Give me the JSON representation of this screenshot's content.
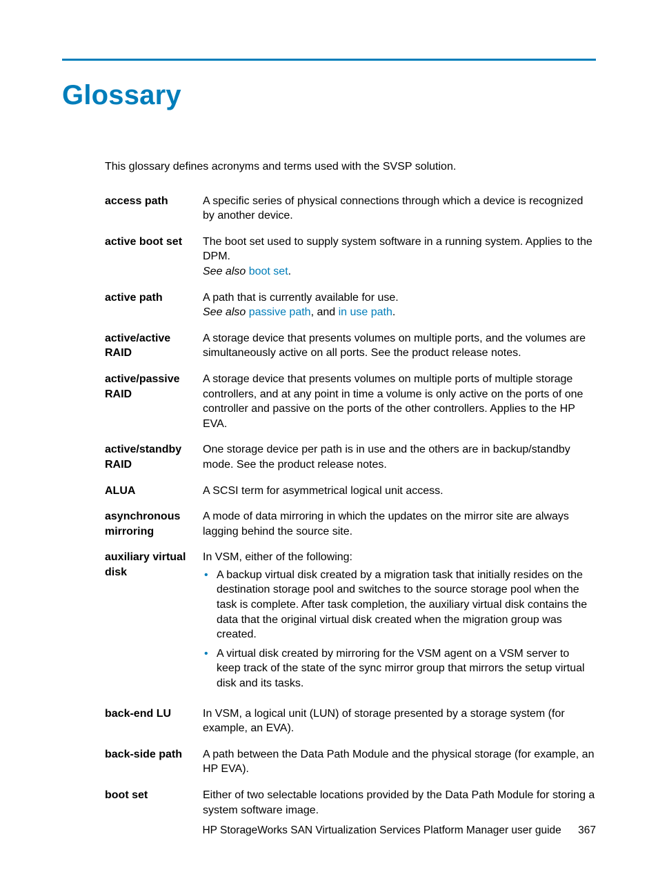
{
  "title": "Glossary",
  "intro": "This glossary defines acronyms and terms used with the SVSP solution.",
  "entries": {
    "access_path": {
      "term": "access path",
      "def": "A specific series of physical connections through which a device is recognized by another device."
    },
    "active_boot_set": {
      "term": "active boot set",
      "def": "The boot set used to supply system software in a running system. Applies to the DPM.",
      "see_also_label": "See also",
      "xref1": "boot set",
      "after": "."
    },
    "active_path": {
      "term": "active path",
      "def": "A path that is currently available for use.",
      "see_also_label": "See also",
      "xref1": "passive path",
      "sep": ", and ",
      "xref2": "in use path",
      "after": "."
    },
    "active_active_raid": {
      "term": "active/active RAID",
      "def": "A storage device that presents volumes on multiple ports, and the volumes are simultaneously active on all ports. See the product release notes."
    },
    "active_passive_raid": {
      "term": "active/passive RAID",
      "def": "A storage device that presents volumes on multiple ports of multiple storage controllers, and at any point in time a volume is only active on the ports of one controller and passive on the ports of the other controllers. Applies to the HP EVA."
    },
    "active_standby_raid": {
      "term": "active/standby RAID",
      "def": "One storage device per path is in use and the others are in backup/standby mode. See the product release notes."
    },
    "alua": {
      "term": "ALUA",
      "def": "A SCSI term for asymmetrical logical unit access."
    },
    "async_mirroring": {
      "term": "asynchronous mirroring",
      "def": "A mode of data mirroring in which the updates on the mirror site are always lagging behind the source site."
    },
    "aux_vdisk": {
      "term": "auxiliary virtual disk",
      "lead": "In VSM, either of the following:",
      "b1": "A backup virtual disk created by a migration task that initially resides on the destination storage pool and switches to the source storage pool when the task is complete. After task completion, the auxiliary virtual disk contains the data that the original virtual disk created when the migration group was created.",
      "b2": "A virtual disk created by mirroring for the VSM agent on a VSM server to keep track of the state of the sync mirror group that mirrors the setup virtual disk and its tasks."
    },
    "back_end_lu": {
      "term": "back-end LU",
      "def": "In VSM, a logical unit (LUN) of storage presented by a storage system (for example, an EVA)."
    },
    "back_side_path": {
      "term": "back-side path",
      "def": "A path between the Data Path Module and the physical storage (for example, an HP EVA)."
    },
    "boot_set": {
      "term": "boot set",
      "def": "Either of two selectable locations provided by the Data Path Module for storing a system software image."
    }
  },
  "footer": {
    "text": "HP StorageWorks SAN Virtualization Services Platform Manager user guide",
    "page": "367"
  }
}
